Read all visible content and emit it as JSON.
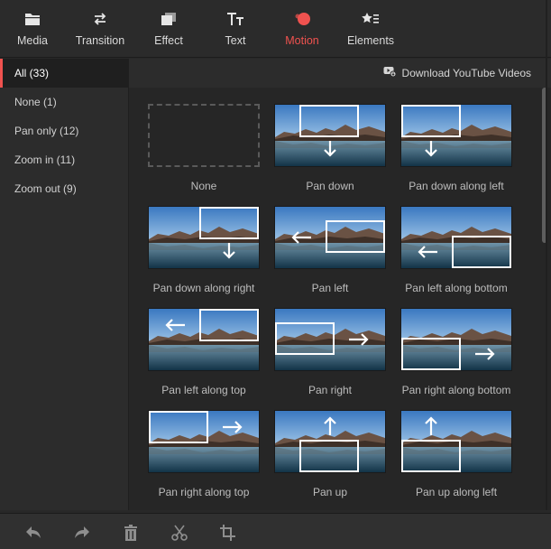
{
  "toolbar": {
    "tabs": [
      {
        "label": "Media",
        "icon": "folder-icon"
      },
      {
        "label": "Transition",
        "icon": "swap-arrows-icon"
      },
      {
        "label": "Effect",
        "icon": "effect-layers-icon"
      },
      {
        "label": "Text",
        "icon": "text-icon"
      },
      {
        "label": "Motion",
        "icon": "motion-icon",
        "active": true
      },
      {
        "label": "Elements",
        "icon": "elements-icon"
      }
    ],
    "active_color": "#f0524f"
  },
  "sidebar": {
    "items": [
      {
        "label": "All (33)",
        "active": true
      },
      {
        "label": "None (1)"
      },
      {
        "label": "Pan only (12)"
      },
      {
        "label": "Zoom in (11)"
      },
      {
        "label": "Zoom out (9)"
      }
    ]
  },
  "main": {
    "download_label": "Download YouTube Videos",
    "motions": [
      {
        "name": "None",
        "kind": "none"
      },
      {
        "name": "Pan down",
        "arrow": "down"
      },
      {
        "name": "Pan down along left",
        "arrow": "down"
      },
      {
        "name": "Pan down along right",
        "arrow": "down"
      },
      {
        "name": "Pan left",
        "arrow": "left"
      },
      {
        "name": "Pan left along bottom",
        "arrow": "left"
      },
      {
        "name": "Pan left along top",
        "arrow": "left"
      },
      {
        "name": "Pan right",
        "arrow": "right"
      },
      {
        "name": "Pan right along bottom",
        "arrow": "right"
      },
      {
        "name": "Pan right along top",
        "arrow": "right"
      },
      {
        "name": "Pan up",
        "arrow": "up"
      },
      {
        "name": "Pan up along left",
        "arrow": "up"
      }
    ]
  },
  "bottombar": {
    "tools": [
      "undo-icon",
      "redo-icon",
      "delete-icon",
      "cut-icon",
      "crop-icon"
    ]
  }
}
